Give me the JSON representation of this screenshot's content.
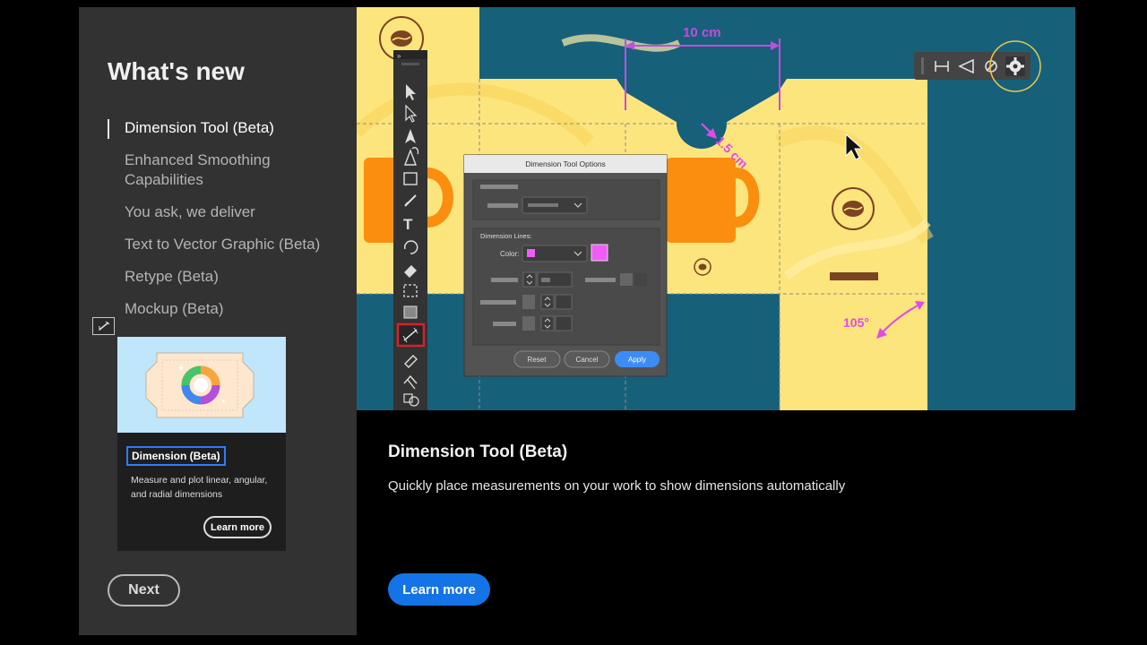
{
  "sidebar": {
    "title": "What's new",
    "features": [
      {
        "label": "Dimension Tool (Beta)",
        "active": true
      },
      {
        "label": "Enhanced Smoothing Capabilities",
        "active": false
      },
      {
        "label": "You ask, we deliver",
        "active": false
      },
      {
        "label": "Text to Vector Graphic (Beta)",
        "active": false
      },
      {
        "label": "Retype (Beta)",
        "active": false
      },
      {
        "label": "Mockup (Beta)",
        "active": false
      }
    ],
    "mini_icon": "dimension-tool-icon"
  },
  "feature_card": {
    "title": "Dimension (Beta)",
    "description": "Measure and plot linear, angular, and radial dimensions",
    "learn_more_label": "Learn more",
    "illustration_icon": "color-wheel-icon"
  },
  "next_label": "Next",
  "hero": {
    "measure_top": "10 cm",
    "measure_radius": "1.5 cm",
    "measure_angle": "105°",
    "colors": {
      "teal": "#17607a",
      "yellow": "#fde57e",
      "orange": "#fb8e0f",
      "magenta": "#e04be6",
      "brown": "#7b4422"
    },
    "dialog": {
      "title": "Dimension Tool Options",
      "section_label": "Dimension Lines:",
      "color_label": "Color:",
      "buttons": {
        "reset": "Reset",
        "cancel": "Cancel",
        "apply": "Apply"
      }
    }
  },
  "detail": {
    "title": "Dimension Tool (Beta)",
    "description": "Quickly place measurements on your work to show dimensions automatically",
    "learn_more_label": "Learn more"
  }
}
